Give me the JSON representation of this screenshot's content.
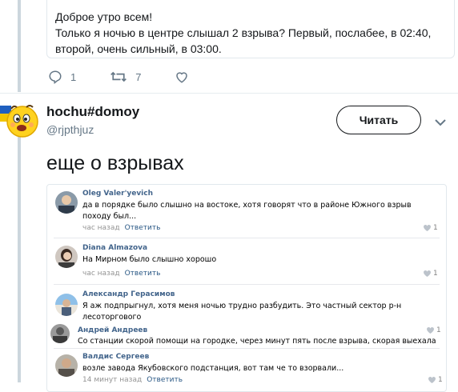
{
  "prev_tweet": {
    "lines": [
      "Доброе утро всем!",
      "Только я ночью в центре слышал 2 взрыва? Первый, послабее, в 02:40,",
      "второй, очень сильный, в 03:00."
    ],
    "reply_count": "1",
    "retweet_count": "7"
  },
  "tweet": {
    "display_name": "hochu#domoy",
    "handle": "@rjpthjuz",
    "follow_label": "Читать",
    "text": "еще о взрывах"
  },
  "comments": [
    {
      "author": "Oleg Valer'yevich",
      "text": "да в порядке было слышно на востоке, хотя говорят что в районе Южного взрыв походу был...",
      "time": "час назад",
      "reply": "Ответить",
      "likes": "1"
    },
    {
      "author": "Diana Almazova",
      "text": "На Мирном было слышно хорошо",
      "time": "час назад",
      "reply": "Ответить",
      "likes": "1"
    },
    {
      "author": "Александр Герасимов",
      "text": "Я аж подпрыгнул, хотя меня ночью трудно разбудить. Это частный сектор р-н лесоторгового",
      "time": "",
      "reply": "",
      "likes": ""
    },
    {
      "author": "Андрей Андреев",
      "text": "Со станции скорой помощи на городке, через минут пять после взрыва, скорая выехала",
      "time": "",
      "reply": "",
      "likes": "1"
    },
    {
      "author": "Валдис Сергеев",
      "text": "возле завода Якубовского подстанция, вот там че то взорвали...",
      "time": "14 минут назад",
      "reply": "Ответить",
      "likes": "1"
    }
  ]
}
